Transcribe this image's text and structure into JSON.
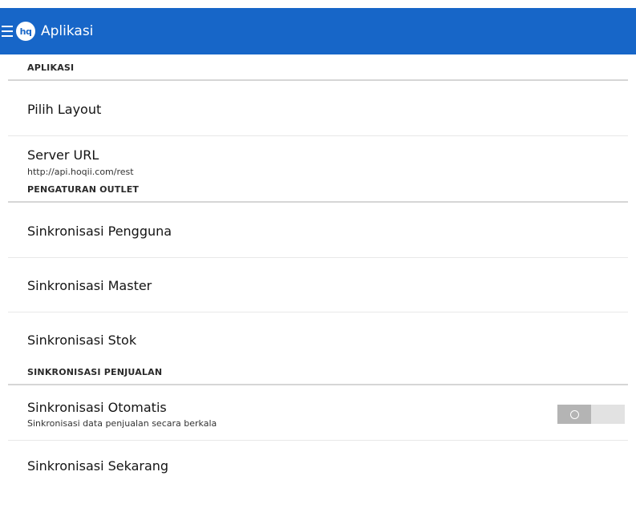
{
  "app": {
    "title": "Aplikasi",
    "logo_text": "hq",
    "accent": "#1766c8"
  },
  "sections": {
    "aplikasi": "APLIKASI",
    "outlet": "PENGATURAN OUTLET",
    "penjualan": "SINKRONISASI PENJUALAN"
  },
  "items": {
    "pilih_layout": {
      "title": "Pilih Layout"
    },
    "server_url": {
      "title": "Server URL",
      "summary": "http://api.hoqii.com/rest"
    },
    "sync_pengguna": {
      "title": "Sinkronisasi Pengguna"
    },
    "sync_master": {
      "title": "Sinkronisasi Master"
    },
    "sync_stok": {
      "title": "Sinkronisasi Stok"
    },
    "sync_otomatis": {
      "title": "Sinkronisasi Otomatis",
      "summary": "Sinkronisasi data penjualan secara berkala",
      "enabled": false
    },
    "sync_sekarang": {
      "title": "Sinkronisasi Sekarang"
    }
  },
  "icons": {
    "menu": "hamburger-menu-icon",
    "logo": "hq-logo-icon",
    "toggle_state": "toggle-off-icon"
  }
}
